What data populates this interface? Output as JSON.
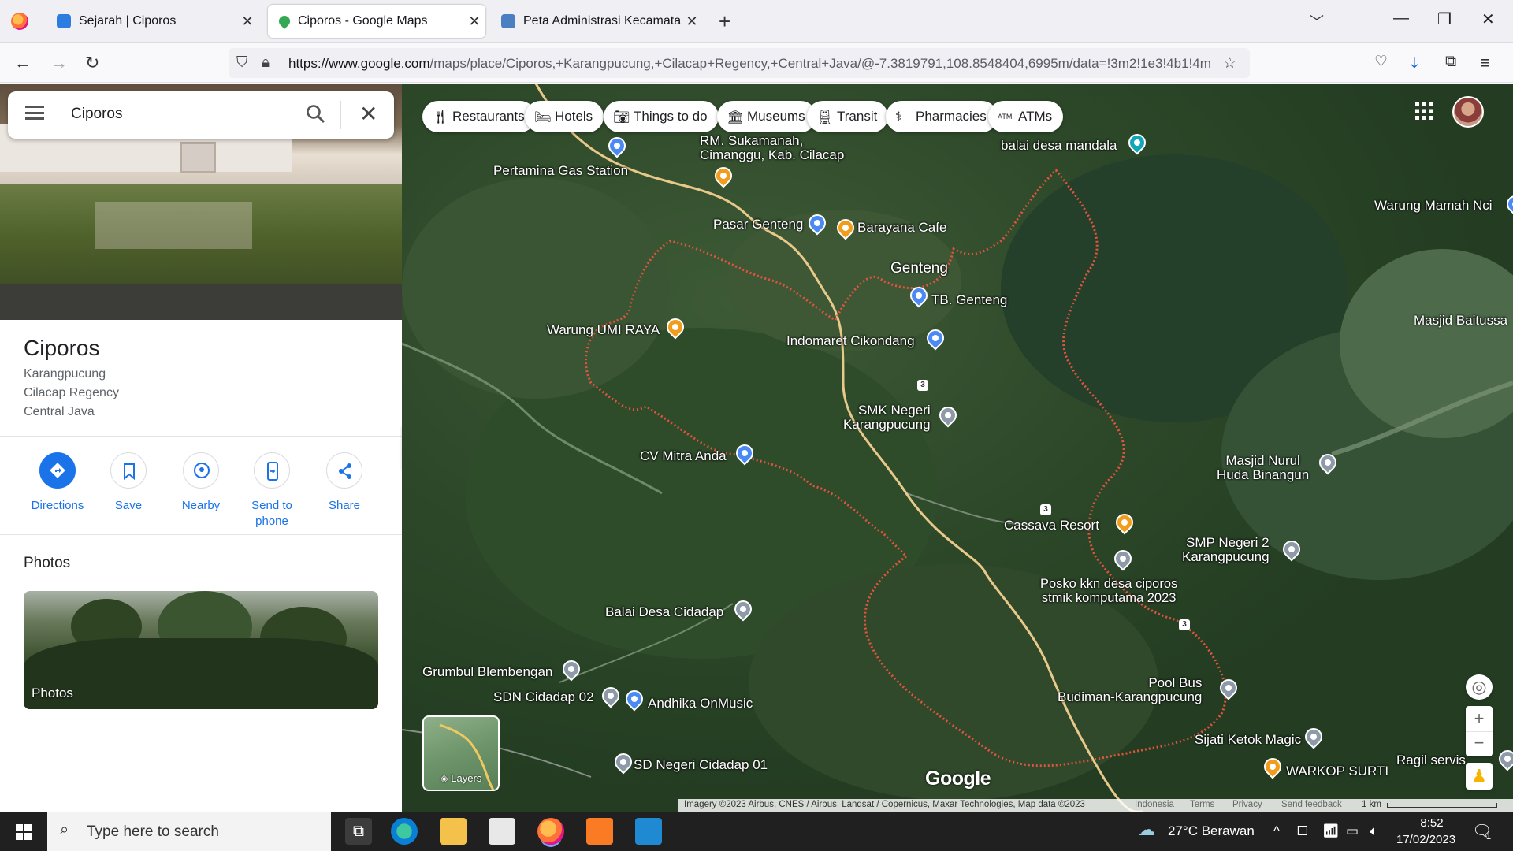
{
  "browser": {
    "tabs": [
      {
        "title": "Sejarah | Ciporos",
        "fav_color": "#2b7de0"
      },
      {
        "title": "Ciporos - Google Maps",
        "fav_color": "#34a853"
      },
      {
        "title": "Peta Administrasi Kecamatan Ka",
        "fav_color": "#4a7fc1"
      }
    ],
    "url_host": "https://www.google.com",
    "url_path": "/maps/place/Ciporos,+Karangpucung,+Cilacap+Regency,+Central+Java/@-7.3819791,108.8548404,6995m/data=!3m2!1e3!4b1!4m"
  },
  "search": {
    "query": "Ciporos"
  },
  "place": {
    "name": "Ciporos",
    "address_lines": [
      "Karangpucung",
      "Cilacap Regency",
      "Central Java"
    ]
  },
  "actions": [
    {
      "label": "Directions",
      "icon": "directions-icon"
    },
    {
      "label": "Save",
      "icon": "bookmark-icon"
    },
    {
      "label": "Nearby",
      "icon": "nearby-icon"
    },
    {
      "label": "Send to\nphone",
      "icon": "send-to-phone-icon"
    },
    {
      "label": "Share",
      "icon": "share-icon"
    }
  ],
  "photos": {
    "heading": "Photos",
    "tile_label": "Photos"
  },
  "map": {
    "chips": [
      "Restaurants",
      "Hotels",
      "Things to do",
      "Museums",
      "Transit",
      "Pharmacies",
      "ATMs"
    ],
    "layers_label": "Layers",
    "logo": "Google",
    "places": [
      {
        "name": "RM. Sukamanah,\nCimanggu, Kab. Cilacap",
        "pin": "orange"
      },
      {
        "name": "Pertamina Gas Station",
        "pin": "blue"
      },
      {
        "name": "balai desa mandala",
        "pin": "teal"
      },
      {
        "name": "Pasar Genteng",
        "pin": "blue"
      },
      {
        "name": "Barayana Cafe",
        "pin": "orange"
      },
      {
        "name": "Warung Mamah Nci",
        "pin": "blue"
      },
      {
        "name": "Genteng",
        "pin": ""
      },
      {
        "name": "TB. Genteng",
        "pin": "blue"
      },
      {
        "name": "Warung UMI RAYA",
        "pin": "orange"
      },
      {
        "name": "Indomaret Cikondang",
        "pin": "blue"
      },
      {
        "name": "Masjid Baitussa",
        "pin": ""
      },
      {
        "name": "SMK Negeri\nKarangpucung",
        "pin": "grey"
      },
      {
        "name": "CV Mitra Anda",
        "pin": "blue"
      },
      {
        "name": "Masjid Nurul\nHuda Binangun",
        "pin": "grey"
      },
      {
        "name": "Cassava Resort",
        "pin": "orange"
      },
      {
        "name": "SMP Negeri 2\nKarangpucung",
        "pin": "grey"
      },
      {
        "name": "Posko kkn desa ciporos\nstmik komputama 2023",
        "pin": "grey"
      },
      {
        "name": "Balai Desa Cidadap",
        "pin": "grey"
      },
      {
        "name": "Grumbul Blembengan",
        "pin": "grey"
      },
      {
        "name": "SDN Cidadap 02",
        "pin": "grey"
      },
      {
        "name": "Andhika OnMusic",
        "pin": "blue"
      },
      {
        "name": "Pool Bus\nBudiman-Karangpucung",
        "pin": "grey"
      },
      {
        "name": "Sijati Ketok Magic",
        "pin": "grey"
      },
      {
        "name": "Ragil servis",
        "pin": "grey"
      },
      {
        "name": "WARKOP SURTI",
        "pin": "orange"
      },
      {
        "name": "SD Negeri Cidadap 01",
        "pin": "grey"
      }
    ],
    "road_numbers": [
      "3",
      "3",
      "3"
    ],
    "attribution": "Imagery ©2023 Airbus, CNES / Airbus, Landsat / Copernicus, Maxar Technologies, Map data ©2023",
    "footer_links": [
      "Indonesia",
      "Terms",
      "Privacy",
      "Send feedback"
    ],
    "scale": "1 km"
  },
  "taskbar": {
    "search_placeholder": "Type here to search",
    "weather": "27°C  Berawan",
    "time": "8:52",
    "date": "17/02/2023",
    "notif_count": "1"
  }
}
